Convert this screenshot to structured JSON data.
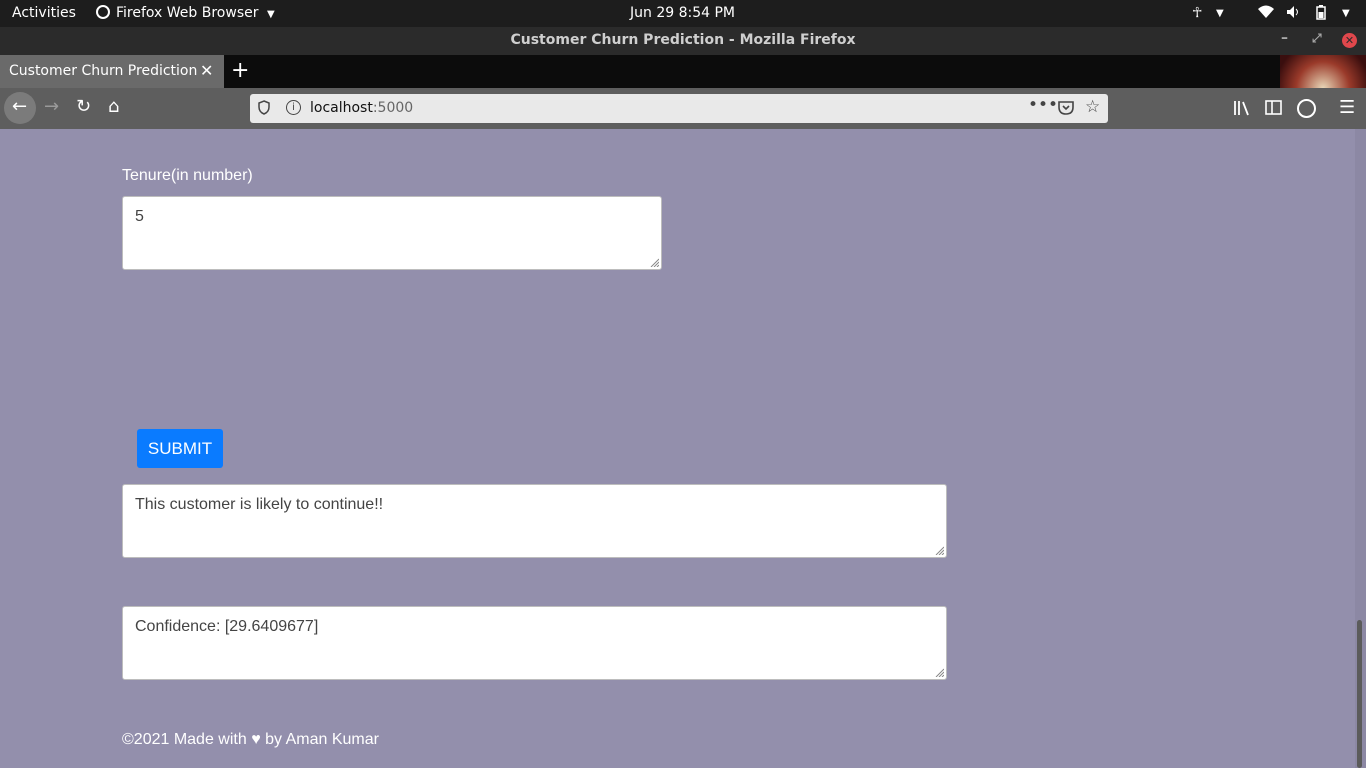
{
  "system": {
    "activities": "Activities",
    "app_menu": "Firefox Web Browser",
    "clock": "Jun 29   8:54 PM"
  },
  "window": {
    "title": "Customer Churn Prediction - Mozilla Firefox"
  },
  "tabs": [
    {
      "label": "Customer Churn Prediction"
    }
  ],
  "url": {
    "host": "localhost",
    "port": ":5000"
  },
  "form": {
    "tenure_label": "Tenure(in number)",
    "tenure_value": "5",
    "submit_label": "SUBMIT",
    "prediction_text": "This customer is likely to continue!!",
    "confidence_text": "Confidence: [29.6409677]"
  },
  "footer": {
    "text": "©2021 Made with ♥ by Aman Kumar"
  },
  "colors": {
    "page_bg": "#938fac",
    "submit_bg": "#0a7bff"
  }
}
